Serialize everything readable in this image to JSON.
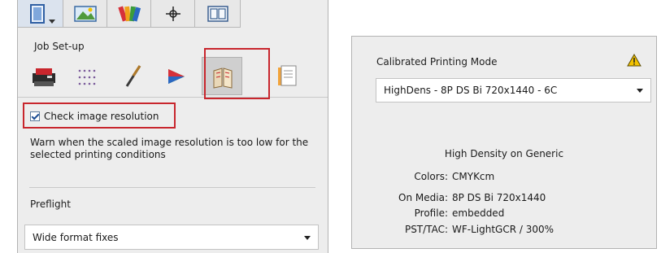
{
  "left_panel": {
    "top_tabs": [
      {
        "icon": "document-settings-icon",
        "has_dropdown": true
      },
      {
        "icon": "image-layout-icon"
      },
      {
        "icon": "color-swatches-icon"
      },
      {
        "icon": "crosshair-icon"
      },
      {
        "icon": "frame-preview-icon"
      }
    ],
    "section_label": "Job Set-up",
    "sub_tabs": [
      {
        "icon": "printer-icon"
      },
      {
        "icon": "grid-dots-icon"
      },
      {
        "icon": "pen-icon"
      },
      {
        "icon": "color-triangle-icon"
      },
      {
        "icon": "book-pages-icon",
        "active": true
      },
      {
        "icon": "document-stack-icon"
      }
    ],
    "check_image_resolution": {
      "label": "Check image resolution",
      "checked": true
    },
    "warning_text": "Warn when the scaled image resolution is too low for the selected printing conditions",
    "preflight": {
      "label": "Preflight",
      "selected": "Wide format fixes"
    }
  },
  "right_panel": {
    "calibrated_label": "Calibrated Printing Mode",
    "warning_icon": "warning-triangle-icon",
    "mode_selected": "HighDens - 8P DS Bi 720x1440 - 6C",
    "info_heading": "High Density on Generic",
    "info_rows": [
      {
        "key": "Colors:",
        "value": "CMYKcm"
      },
      {
        "key": "On Media:",
        "value": "8P DS Bi 720x1440"
      },
      {
        "key": "Profile:",
        "value": "embedded"
      },
      {
        "key": "PST/TAC:",
        "value": "WF-LightGCR  /  300%"
      }
    ]
  },
  "colors": {
    "highlight_red": "#c8262d",
    "panel_bg": "#ededed",
    "warning_yellow": "#f2c200"
  }
}
